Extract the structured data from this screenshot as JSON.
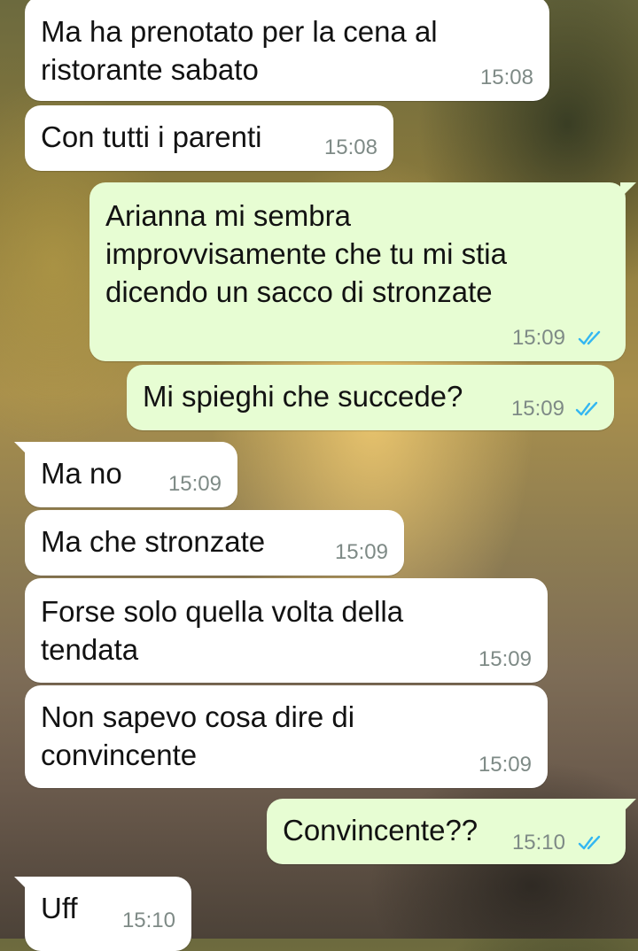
{
  "messages": [
    {
      "text": "Ma ha prenotato per la cena al\nristorante sabato",
      "time": "15:08"
    },
    {
      "text": "Con tutti i parenti",
      "time": "15:08"
    },
    {
      "text": "Arianna mi sembra\nimprovvisamente che tu mi stia\ndicendo un sacco di stronzate",
      "time": "15:09",
      "status": "read-double-check-icon"
    },
    {
      "text": "Mi spieghi che succede?",
      "time": "15:09",
      "status": "read-double-check-icon"
    },
    {
      "text": "Ma no",
      "time": "15:09"
    },
    {
      "text": "Ma che stronzate",
      "time": "15:09"
    },
    {
      "text": "Forse solo quella volta della\ntendata",
      "time": "15:09"
    },
    {
      "text": "Non sapevo cosa dire di\nconvincente",
      "time": "15:09"
    },
    {
      "text": "Convincente??",
      "time": "15:10",
      "status": "read-double-check-icon"
    },
    {
      "text": "Uff",
      "time": "15:10"
    }
  ],
  "colors": {
    "incoming_bubble": "#ffffff",
    "outgoing_bubble": "#e7fdd3",
    "read_ticks": "#34b7f1",
    "timestamp": "#7e8a86"
  }
}
